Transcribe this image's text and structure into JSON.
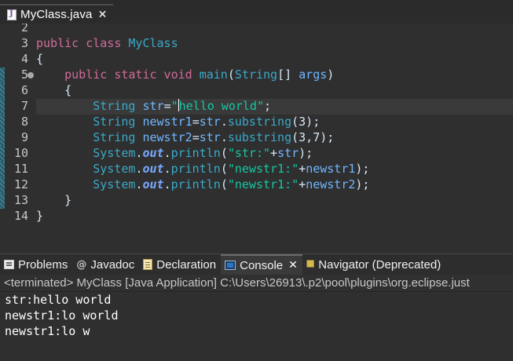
{
  "editor_tab": {
    "title": "MyClass.java"
  },
  "editor": {
    "line_numbers": [
      "2",
      "3",
      "4",
      "5",
      "6",
      "7",
      "8",
      "9",
      "10",
      "11",
      "12",
      "13",
      "14",
      ""
    ],
    "lines": [
      {
        "parts": []
      },
      {
        "parts": [
          {
            "t": "public class ",
            "c": "kw"
          },
          {
            "t": "MyClass",
            "c": "cls"
          }
        ]
      },
      {
        "parts": [
          {
            "t": "{",
            "c": ""
          }
        ]
      },
      {
        "parts": [
          {
            "t": "    ",
            "c": ""
          },
          {
            "t": "public static void ",
            "c": "kw"
          },
          {
            "t": "main",
            "c": "cls"
          },
          {
            "t": "(",
            "c": ""
          },
          {
            "t": "String",
            "c": "type"
          },
          {
            "t": "[] ",
            "c": ""
          },
          {
            "t": "args",
            "c": "var"
          },
          {
            "t": ")",
            "c": ""
          }
        ]
      },
      {
        "parts": [
          {
            "t": "    {",
            "c": ""
          }
        ]
      },
      {
        "parts": [
          {
            "t": "        ",
            "c": ""
          },
          {
            "t": "String",
            "c": "type"
          },
          {
            "t": " ",
            "c": ""
          },
          {
            "t": "str",
            "c": "var"
          },
          {
            "t": "=",
            "c": ""
          },
          {
            "t": "\"",
            "c": "str"
          },
          {
            "t": "|",
            "c": "cursor"
          },
          {
            "t": "hello world\"",
            "c": "str"
          },
          {
            "t": ";",
            "c": ""
          }
        ]
      },
      {
        "parts": [
          {
            "t": "        ",
            "c": ""
          },
          {
            "t": "String",
            "c": "type"
          },
          {
            "t": " ",
            "c": ""
          },
          {
            "t": "newstr1",
            "c": "var"
          },
          {
            "t": "=",
            "c": ""
          },
          {
            "t": "str",
            "c": "var"
          },
          {
            "t": ".",
            "c": ""
          },
          {
            "t": "substring",
            "c": "cls"
          },
          {
            "t": "(3);",
            "c": ""
          }
        ]
      },
      {
        "parts": [
          {
            "t": "        ",
            "c": ""
          },
          {
            "t": "String",
            "c": "type"
          },
          {
            "t": " ",
            "c": ""
          },
          {
            "t": "newstr2",
            "c": "var"
          },
          {
            "t": "=",
            "c": ""
          },
          {
            "t": "str",
            "c": "var"
          },
          {
            "t": ".",
            "c": ""
          },
          {
            "t": "substring",
            "c": "cls"
          },
          {
            "t": "(3,7);",
            "c": ""
          }
        ]
      },
      {
        "parts": [
          {
            "t": "        ",
            "c": ""
          },
          {
            "t": "System",
            "c": "type"
          },
          {
            "t": ".",
            "c": ""
          },
          {
            "t": "out",
            "c": "fld"
          },
          {
            "t": ".",
            "c": ""
          },
          {
            "t": "println",
            "c": "cls"
          },
          {
            "t": "(",
            "c": ""
          },
          {
            "t": "\"str:\"",
            "c": "str"
          },
          {
            "t": "+",
            "c": ""
          },
          {
            "t": "str",
            "c": "var"
          },
          {
            "t": ");",
            "c": ""
          }
        ]
      },
      {
        "parts": [
          {
            "t": "        ",
            "c": ""
          },
          {
            "t": "System",
            "c": "type"
          },
          {
            "t": ".",
            "c": ""
          },
          {
            "t": "out",
            "c": "fld"
          },
          {
            "t": ".",
            "c": ""
          },
          {
            "t": "println",
            "c": "cls"
          },
          {
            "t": "(",
            "c": ""
          },
          {
            "t": "\"newstr1:\"",
            "c": "str"
          },
          {
            "t": "+",
            "c": ""
          },
          {
            "t": "newstr1",
            "c": "var"
          },
          {
            "t": ");",
            "c": ""
          }
        ]
      },
      {
        "parts": [
          {
            "t": "        ",
            "c": ""
          },
          {
            "t": "System",
            "c": "type"
          },
          {
            "t": ".",
            "c": ""
          },
          {
            "t": "out",
            "c": "fld"
          },
          {
            "t": ".",
            "c": ""
          },
          {
            "t": "println",
            "c": "cls"
          },
          {
            "t": "(",
            "c": ""
          },
          {
            "t": "\"newstr1:\"",
            "c": "str"
          },
          {
            "t": "+",
            "c": ""
          },
          {
            "t": "newstr2",
            "c": "var"
          },
          {
            "t": ");",
            "c": ""
          }
        ]
      },
      {
        "parts": [
          {
            "t": "    }",
            "c": ""
          }
        ]
      },
      {
        "parts": [
          {
            "t": "}",
            "c": ""
          }
        ]
      },
      {
        "parts": []
      }
    ],
    "current_line_index": 5
  },
  "view_tabs": [
    {
      "label": "Problems",
      "icon": "problems-icon",
      "active": false
    },
    {
      "label": "Javadoc",
      "icon": "javadoc-icon",
      "active": false
    },
    {
      "label": "Declaration",
      "icon": "declaration-icon",
      "active": false
    },
    {
      "label": "Console",
      "icon": "console-icon",
      "active": true
    },
    {
      "label": "Navigator (Deprecated)",
      "icon": "navigator-icon",
      "active": false
    }
  ],
  "console": {
    "header": "<terminated> MyClass [Java Application] C:\\Users\\26913\\.p2\\pool\\plugins\\org.eclipse.just",
    "output": [
      "str:hello world",
      "newstr1:lo world",
      "newstr1:lo w"
    ]
  }
}
